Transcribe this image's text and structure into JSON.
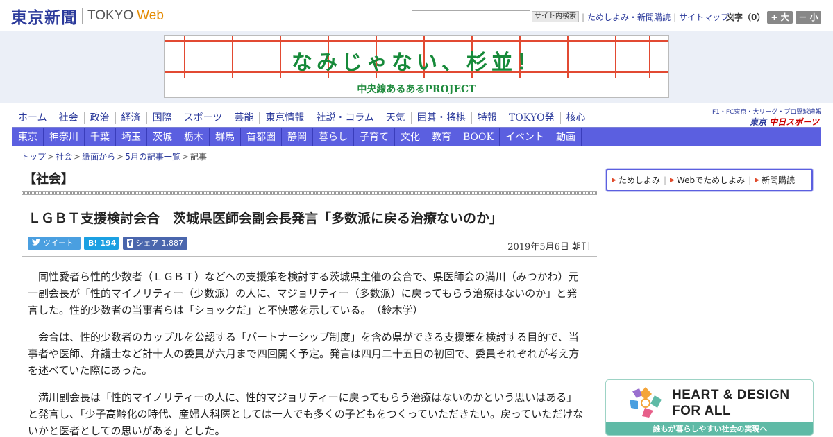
{
  "header": {
    "logo_jp": "東京新聞",
    "logo_tokyo": "TOKYO",
    "logo_web": "Web",
    "search_placeholder": "",
    "search_button": "サイト内検索",
    "links": [
      "ためしよみ・新聞購読",
      "サイトマップ"
    ],
    "font_size_label": "文字（0）",
    "font_large": "+ 大",
    "font_small": "－ 小"
  },
  "banner": {
    "title": "なみじゃない、杉並！",
    "subtitle": "中央線あるあるPROJECT"
  },
  "main_nav": [
    "ホーム",
    "社会",
    "政治",
    "経済",
    "国際",
    "スポーツ",
    "芸能",
    "東京情報",
    "社説・コラム",
    "天気",
    "囲碁・将棋",
    "特報",
    "TOKYO発",
    "核心"
  ],
  "chunichi": {
    "top": "F1・FC東京・大リーグ・プロ野球速報",
    "logo_prefix": "東京",
    "logo_name": "中日スポーツ"
  },
  "region_nav": [
    "東京",
    "神奈川",
    "千葉",
    "埼玉",
    "茨城",
    "栃木",
    "群馬",
    "首都圏",
    "静岡",
    "暮らし",
    "子育て",
    "文化",
    "教育",
    "BOOK",
    "イベント",
    "動画"
  ],
  "breadcrumb": [
    "トップ",
    "社会",
    "紙面から",
    "5月の記事一覧",
    "記事"
  ],
  "article": {
    "section": "【社会】",
    "headline": "ＬＧＢＴ支援検討会合　茨城県医師会副会長発言「多数派に戻る治療ないのか」",
    "tweet_label": "ツイート",
    "hatena_label": "B!",
    "hatena_count": "194",
    "fb_label": "シェア",
    "fb_count": "1,887",
    "date": "2019年5月6日 朝刊",
    "paragraphs": [
      "同性愛者ら性的少数者（ＬＧＢＴ）などへの支援策を検討する茨城県主催の会合で、県医師会の満川（みつかわ）元一副会長が「性的マイノリティー（少数派）の人に、マジョリティー（多数派）に戻ってもらう治療はないのか」と発言した。性的少数者の当事者らは「ショックだ」と不快感を示している。　（鈴木学）",
      "会合は、性的少数者のカップルを公認する「パートナーシップ制度」を含め県ができる支援策を検討する目的で、当事者や医師、弁護士など計十人の委員が六月まで四回開く予定。発言は四月二十五日の初回で、委員それぞれが考え方を述べていた際にあった。",
      "満川副会長は「性的マイノリティーの人に、性的マジョリティーに戻ってもらう治療はないのかという思いはある」と発言し、「少子高齢化の時代、産婦人科医としては一人でも多くの子どもをつくっていただきたい。戻っていただけないかと医者としての思いがある」とした。"
    ]
  },
  "subscribe": [
    "ためしよみ",
    "Webでためしよみ",
    "新聞購読"
  ],
  "heart_ad": {
    "line1": "HEART & DESIGN",
    "line2": "FOR ALL",
    "footer": "誰もが暮らしやすい社会の実現へ"
  },
  "colors": {
    "brand_blue": "#2b3a9b",
    "region_nav": "#5b5fe0",
    "banner_green": "#178a3a",
    "twitter": "#4a9fe0",
    "hatena": "#1ba0e2",
    "facebook": "#4a66ad",
    "ad_teal": "#5fbaa6"
  }
}
